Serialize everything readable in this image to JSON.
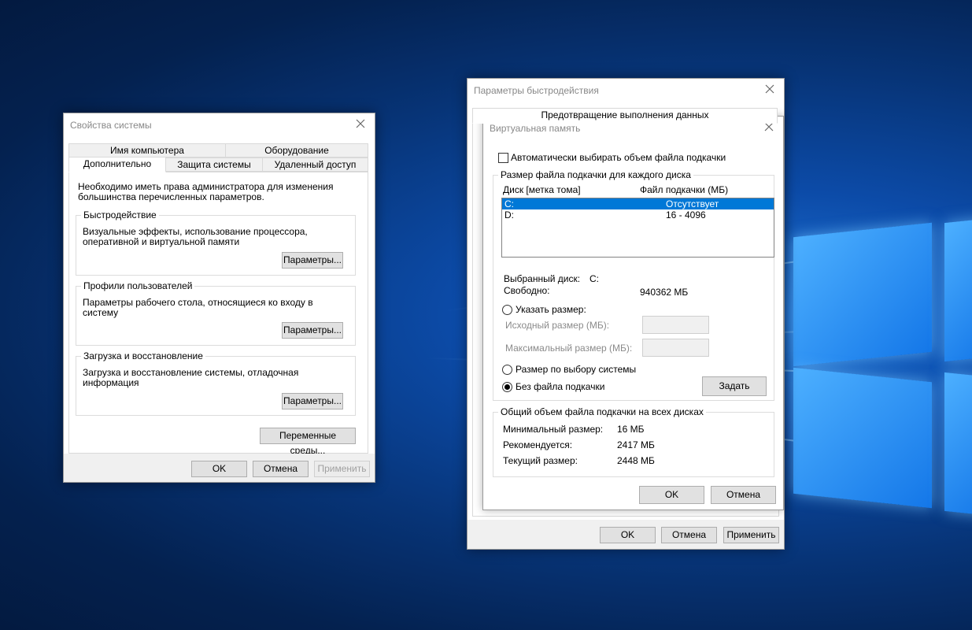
{
  "sys": {
    "title": "Свойства системы",
    "tabs_top": [
      "Имя компьютера",
      "Оборудование"
    ],
    "tabs_bottom": [
      "Дополнительно",
      "Защита системы",
      "Удаленный доступ"
    ],
    "admin_note": "Необходимо иметь права администратора для изменения большинства перечисленных параметров.",
    "perf": {
      "title": "Быстродействие",
      "desc": "Визуальные эффекты, использование процессора, оперативной и виртуальной памяти",
      "button": "Параметры..."
    },
    "profiles": {
      "title": "Профили пользователей",
      "desc": "Параметры рабочего стола, относящиеся ко входу в систему",
      "button": "Параметры..."
    },
    "startup": {
      "title": "Загрузка и восстановление",
      "desc": "Загрузка и восстановление системы, отладочная информация",
      "button": "Параметры..."
    },
    "env_button": "Переменные среды...",
    "ok": "OK",
    "cancel": "Отмена",
    "apply": "Применить"
  },
  "perfwin": {
    "title": "Параметры быстродействия",
    "tab_partial": "Предотвращение выполнения данных",
    "ok": "OK",
    "cancel": "Отмена",
    "apply": "Применить"
  },
  "vm": {
    "title": "Виртуальная память",
    "auto_label": "Автоматически выбирать объем файла подкачки",
    "auto_checked": false,
    "group_title": "Размер файла подкачки для каждого диска",
    "col_disk": "Диск [метка тома]",
    "col_file": "Файл подкачки (МБ)",
    "drives": [
      {
        "disk": "C:",
        "size": "Отсутствует",
        "selected": true
      },
      {
        "disk": "D:",
        "size": "16 - 4096",
        "selected": false
      }
    ],
    "selected_label": "Выбранный диск:",
    "selected_value": "C:",
    "free_label": "Свободно:",
    "free_value": "940362 МБ",
    "custom_label": "Указать размер:",
    "initial_label": "Исходный размер (МБ):",
    "max_label": "Максимальный размер (МБ):",
    "system_label": "Размер по выбору системы",
    "none_label": "Без файла подкачки",
    "set_button": "Задать",
    "total_title": "Общий объем файла подкачки на всех дисках",
    "min_label": "Минимальный размер:",
    "min_value": "16 МБ",
    "rec_label": "Рекомендуется:",
    "rec_value": "2417 МБ",
    "cur_label": "Текущий размер:",
    "cur_value": "2448 МБ",
    "ok": "OK",
    "cancel": "Отмена"
  }
}
